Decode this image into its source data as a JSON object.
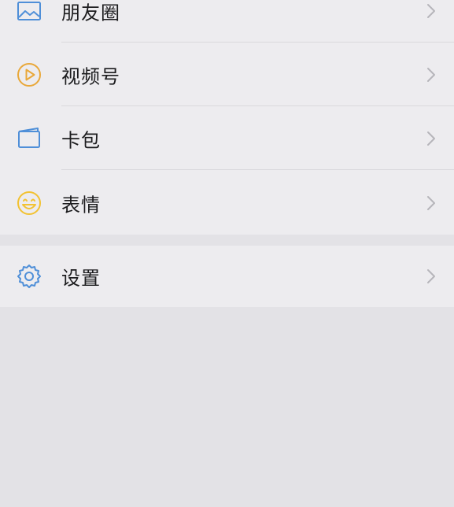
{
  "menu_group_1": {
    "items": [
      {
        "label": "朋友圈",
        "icon": "moments-picture-icon",
        "icon_color": "#4f8fd8"
      },
      {
        "label": "视频号",
        "icon": "channels-play-icon",
        "icon_color": "#e9a83a"
      },
      {
        "label": "卡包",
        "icon": "card-wallet-icon",
        "icon_color": "#4f8fd8"
      },
      {
        "label": "表情",
        "icon": "sticker-smiley-icon",
        "icon_color": "#f2c232"
      }
    ]
  },
  "menu_group_2": {
    "items": [
      {
        "label": "设置",
        "icon": "settings-gear-icon",
        "icon_color": "#4f8fd8"
      }
    ]
  },
  "colors": {
    "background": "#e3e2e6",
    "cell_background": "#edecef",
    "text": "#1c1c1e",
    "chevron": "#b6b5ba",
    "divider": "#d9d8dc"
  }
}
